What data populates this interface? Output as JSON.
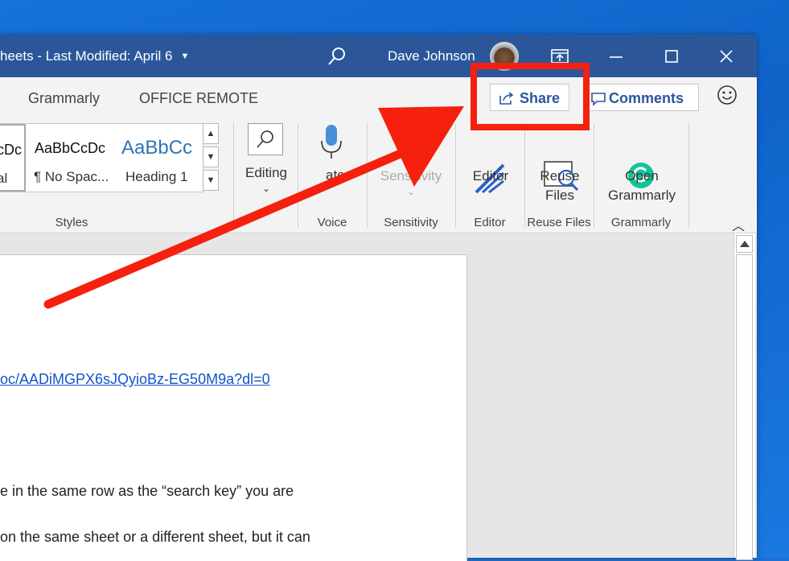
{
  "titlebar": {
    "doc_title": "heets  -  Last Modified: April 6",
    "user_name": "Dave Johnson"
  },
  "tabs": [
    {
      "label": "Grammarly"
    },
    {
      "label": "OFFICE REMOTE"
    }
  ],
  "share_label": "Share",
  "comments_label": "Comments",
  "styles_gallery": {
    "items": [
      {
        "preview": "cDc",
        "name": "al"
      },
      {
        "preview": "AaBbCcDc",
        "name": "¶ No Spac..."
      },
      {
        "preview": "AaBbCc",
        "name": "Heading 1"
      }
    ],
    "group_label": "Styles"
  },
  "ribbon": {
    "editing_label": "Editing",
    "dictate_label": "ate",
    "voice_group": "Voice",
    "sensitivity_label": "Sensitivity",
    "sensitivity_group": "Sensitivity",
    "editor_label": "Editor",
    "editor_group": "Editor",
    "reuse_line1": "Reuse",
    "reuse_line2": "Files",
    "reuse_group": "Reuse Files",
    "open_line1": "Open",
    "open_line2": "Grammarly",
    "grammarly_group": "Grammarly"
  },
  "document": {
    "link_text": "oc/AADiMGPX6sJQyioBz-EG50M9a?dl=0",
    "line1": "e in the same row as the “search key” you are",
    "line2": "on the same sheet or a different sheet, but it can"
  },
  "colors": {
    "titlebar": "#2b579a",
    "accent_text": "#2b579a",
    "annotation_red": "#f5200d"
  }
}
